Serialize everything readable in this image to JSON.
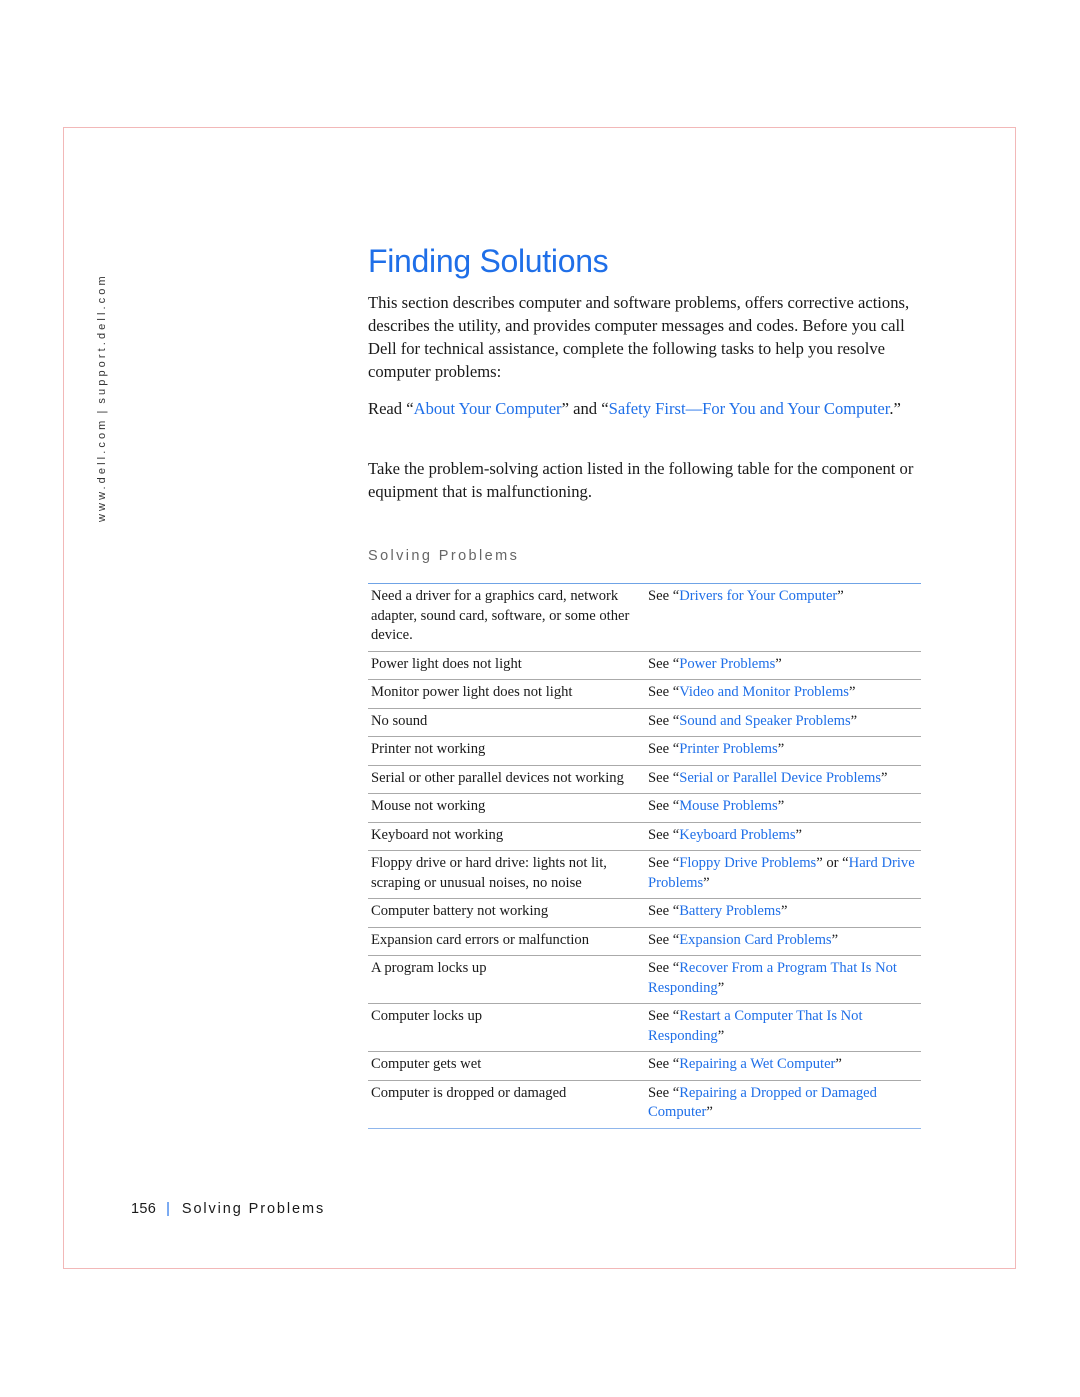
{
  "side_url": {
    "left": "www.dell.com",
    "separator": "|",
    "right": "support.dell.com"
  },
  "title": "Finding Solutions",
  "intro": "This section describes computer and software problems, offers corrective actions, describes the utility, and provides computer messages and codes. Before you call Dell for technical assistance, complete the following tasks to help you resolve computer problems:",
  "read": {
    "prefix": "Read “",
    "link1": "About Your Computer",
    "middle": "” and “",
    "link2": "Safety First—For You and Your Computer",
    "suffix": ".”"
  },
  "take_action": "Take the problem-solving action listed in the following table for the component or equipment that is malfunctioning.",
  "table": {
    "title": "Solving Problems",
    "rows": [
      {
        "problem": "Need a driver for a graphics card, network adapter, sound card, software, or some other device.",
        "see": "See “",
        "link": "Drivers for Your Computer",
        "end": "”"
      },
      {
        "problem": "Power light does not light",
        "see": "See “",
        "link": "Power Problems",
        "end": "”"
      },
      {
        "problem": "Monitor power light does not light",
        "see": "See “",
        "link": "Video and Monitor Problems",
        "end": "”"
      },
      {
        "problem": "No sound",
        "see": "See “",
        "link": "Sound and Speaker Problems",
        "end": "”"
      },
      {
        "problem": "Printer not working",
        "see": "See “",
        "link": "Printer Problems",
        "end": "”"
      },
      {
        "problem": "Serial or other parallel devices not working",
        "see": "See “",
        "link": "Serial or Parallel Device Problems",
        "end": "”"
      },
      {
        "problem": "Mouse not working",
        "see": "See “",
        "link": "Mouse Problems",
        "end": "”"
      },
      {
        "problem": "Keyboard not working",
        "see": "See “",
        "link": "Keyboard Problems",
        "end": "”"
      },
      {
        "problem": "Floppy drive or hard drive: lights not lit, scraping or unusual noises, no noise",
        "see": "See “",
        "link": "Floppy Drive Problems",
        "mid": "” or “",
        "link2": "Hard Drive Problems",
        "end": "”"
      },
      {
        "problem": "Computer battery not working",
        "see": "See “",
        "link": "Battery Problems",
        "end": "”"
      },
      {
        "problem": "Expansion card errors or malfunction",
        "see": "See “",
        "link": "Expansion Card Problems",
        "end": "”"
      },
      {
        "problem": "A program locks up",
        "see": "See “",
        "link": "Recover From a Program That Is Not Responding",
        "end": "”"
      },
      {
        "problem": "Computer locks up",
        "see": "See “",
        "link": "Restart a Computer That Is Not Responding",
        "end": "”"
      },
      {
        "problem": "Computer gets wet",
        "see": "See “",
        "link": "Repairing a Wet Computer",
        "end": "”"
      },
      {
        "problem": "Computer is dropped or damaged",
        "see": "See “",
        "link": "Repairing a Dropped or Damaged Computer",
        "end": "”"
      }
    ]
  },
  "footer": {
    "page_number": "156",
    "separator": "|",
    "section": "Solving Problems"
  },
  "colors": {
    "accent": "#1f6fe8",
    "frame": "#f2b8b8"
  }
}
